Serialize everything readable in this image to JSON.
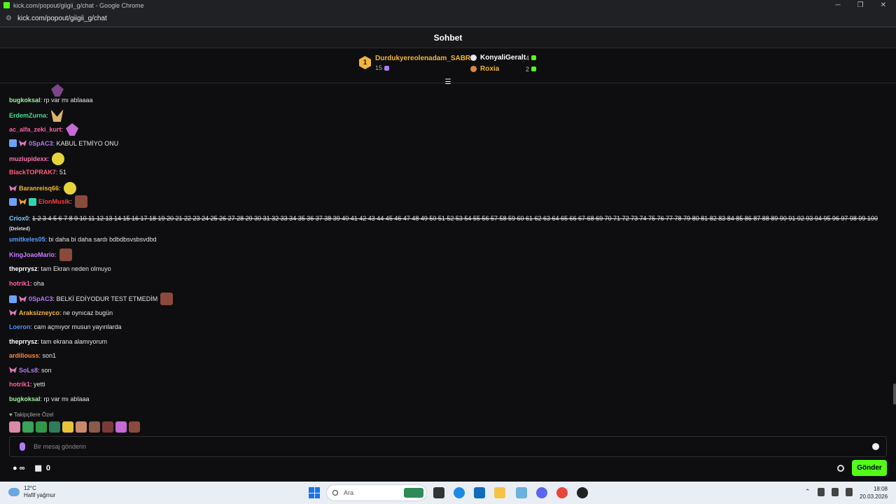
{
  "window": {
    "title": "kick.com/popout/giigii_g/chat - Google Chrome",
    "url": "kick.com/popout/giigii_g/chat"
  },
  "chat_header": {
    "title": "Sohbet"
  },
  "leaderboard": {
    "first": {
      "rank": "1",
      "name": "Durdukyereolenadam_SABRI",
      "count": "15"
    },
    "second": {
      "name": "KonyaliGeralt",
      "count": "4"
    },
    "third": {
      "name": "Roxia",
      "count": "2"
    }
  },
  "messages": [
    {
      "user": "bugkoksal",
      "color": "#9cf0a0",
      "text": ": rp var mı ablaaaa"
    },
    {
      "user": "ErdemZurna",
      "color": "#3fe08a",
      "text": ":"
    },
    {
      "user": "ac_alfa_zeki_kurt",
      "color": "#ff5fa0",
      "text": ":"
    },
    {
      "user": "0SpAC3",
      "color": "#b07cf1",
      "text": ": KABUL ETMİYO ONU"
    },
    {
      "user": "muzlupidexx",
      "color": "#ff6fb0",
      "text": ":"
    },
    {
      "user": "BlackTOPRAK7",
      "color": "#ff5f7a",
      "text": ": 51"
    },
    {
      "user": "Baranreisq66",
      "color": "#f1b53b",
      "text": ":"
    },
    {
      "user": "ElonMusik",
      "color": "#ff3b3b",
      "text": ":"
    },
    {
      "user": "umitkeles05",
      "color": "#5a9bff",
      "text": ": bi daha bi daha sardı bdbdbsvsbsvdbd"
    },
    {
      "user": "KingJoaoMario",
      "color": "#c77dff",
      "text": ":"
    },
    {
      "user": "theprrysz",
      "color": "#ffffff",
      "text": ": tam Ekran neden olmuyo"
    },
    {
      "user": "hotrik1",
      "color": "#ff5f9f",
      "text": ": oha"
    },
    {
      "user": "0SpAC3",
      "color": "#b07cf1",
      "text": ": BELKİ EDİYODUR TEST ETMEDİM"
    },
    {
      "user": "Araksizneyco",
      "color": "#f1b53b",
      "text": ": ne oynıcaz bugün"
    },
    {
      "user": "Loeron",
      "color": "#4f8dff",
      "text": ": cam açmıyor musun yayınlarda"
    },
    {
      "user": "theprrysz",
      "color": "#ffffff",
      "text": ": tam ekrana alamıyorum"
    },
    {
      "user": "ardiliouss",
      "color": "#ff8a3b",
      "text": ": son1"
    },
    {
      "user": "SoLs8",
      "color": "#b07cf1",
      "text": ": son"
    },
    {
      "user": "hotrik1",
      "color": "#ff5f9f",
      "text": ": yetti"
    },
    {
      "user": "bugkoksal",
      "color": "#9cf0a0",
      "text": ": rp var mı ablaaa"
    }
  ],
  "number_message": {
    "user": "Criox0",
    "numbers": "1 2 3 4 5 6 7 8 9 10 11 12 13 14 15 16 17 18 19 20 21 22 23 24 25 26 27 28 29 30 31 32 33 34 35 36 37 38 39 40 41 42 43 44 45 46 47 48 49 50 51 52 53 54 55 56 57 58 59 60 61 62 63 64 65 66 67 68 69 70 71 72 73 74 75 76 77 78 79 80 81 82 83 84 85 86 87 88 89 90 91 92 93 94 95 96 97 98 99 100",
    "deleted_label": "(Deleted)"
  },
  "followers_label": "Takipçilere Özel",
  "input": {
    "placeholder": "Bir mesaj gönderin"
  },
  "bottom": {
    "points": "0",
    "send_label": "Gönder"
  },
  "taskbar": {
    "weather_temp": "12°C",
    "weather_desc": "Hafif yağmur",
    "search_label": "Ara",
    "time": "18:08",
    "date": "20.03.2026"
  }
}
